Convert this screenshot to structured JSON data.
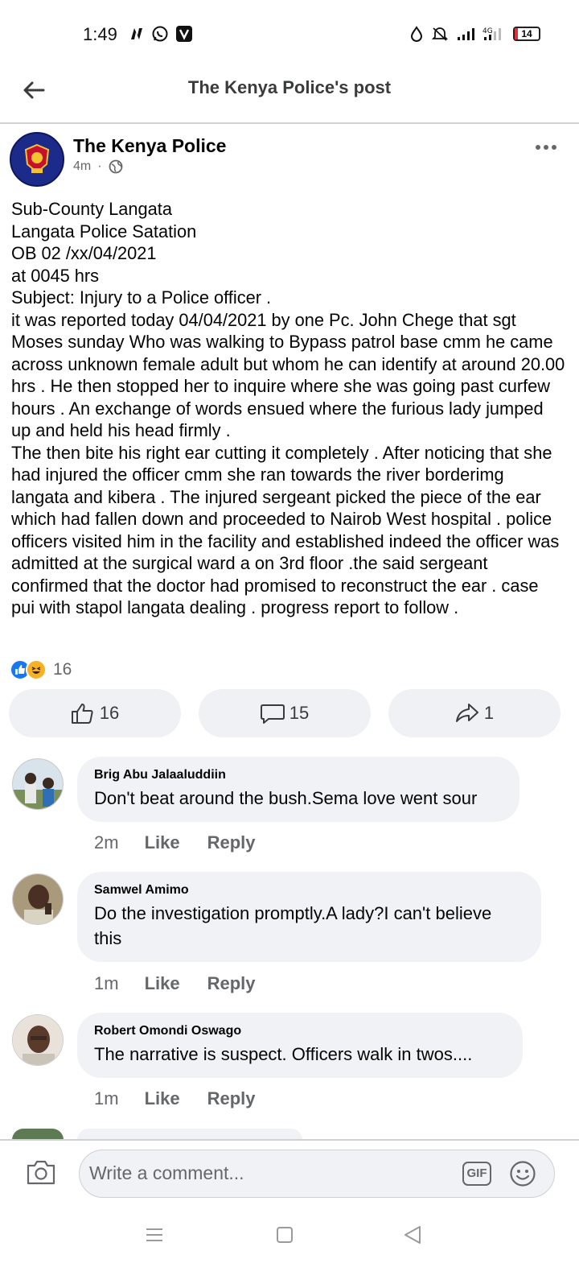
{
  "status_bar": {
    "time": "1:49",
    "battery": "14"
  },
  "header": {
    "title": "The Kenya Police's post"
  },
  "post": {
    "author": "The Kenya Police",
    "time": "4m",
    "separator": "·",
    "body": "Sub-County Langata\nLangata Police Satation\nOB 02 /xx/04/2021\nat 0045 hrs\nSubject: Injury to a Police officer .\nit was reported today 04/04/2021 by one  Pc. John Chege that sgt Moses sunday Who was walking  to Bypass patrol base cmm he came across unknown female adult but whom he can identify at around 20.00 hrs . He then stopped her to inquire where she was going past curfew hours . An exchange of words ensued where the furious lady jumped up and held his head firmly .\nThe then bite his right ear cutting it completely . After noticing that she had injured the officer cmm she ran towards the river borderimg langata and kibera . The injured sergeant picked the piece of the ear which had fallen down and proceeded to Nairob West hospital . police officers visited him in the facility and established indeed the officer was admitted at the surgical ward a on 3rd floor .the said sergeant confirmed that  the doctor had promised to reconstruct the ear . case pui with stapol langata dealing . progress report to follow .",
    "reaction_count": "16",
    "actions": {
      "like_count": "16",
      "comment_count": "15",
      "share_count": "1"
    }
  },
  "comments": [
    {
      "author": "Brig Abu Jalaaluddiin",
      "text": "Don't beat around the bush.Sema love went sour",
      "time": "2m",
      "like": "Like",
      "reply": "Reply"
    },
    {
      "author": "Samwel Amimo",
      "text": "Do the investigation promptly.A lady?I can't believe this",
      "time": "1m",
      "like": "Like",
      "reply": "Reply"
    },
    {
      "author": "Robert Omondi Oswago",
      "text": "The narrative is suspect.  Officers walk in twos....",
      "time": "1m",
      "like": "Like",
      "reply": "Reply"
    }
  ],
  "composer": {
    "placeholder": "Write a comment...",
    "gif_label": "GIF"
  },
  "colors": {
    "brand_blue": "#1877f2",
    "text_secondary": "#65676b",
    "bubble_bg": "#f0f2f5"
  }
}
